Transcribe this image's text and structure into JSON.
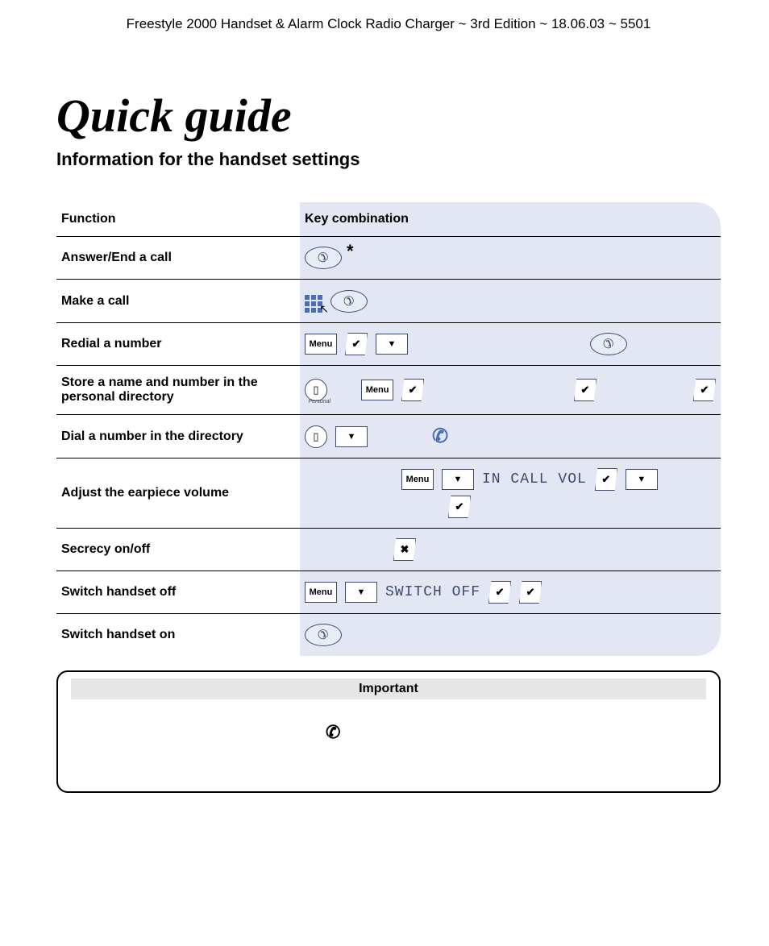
{
  "header": "Freestyle 2000 Handset & Alarm Clock Radio Charger  ~ 3rd Edition ~ 18.06.03 ~ 5501",
  "title": "Quick guide",
  "subtitle": "Information for the handset settings",
  "table": {
    "col_function": "Function",
    "col_key": "Key combination",
    "rows": {
      "answer_end": "Answer/End a call",
      "make_call": "Make a call",
      "redial": "Redial a number",
      "store": "Store a name and number in the personal directory",
      "dial_dir": "Dial a number in the directory",
      "volume": "Adjust the earpiece volume",
      "secrecy": "Secrecy on/off",
      "off": "Switch handset off",
      "on": "Switch handset on"
    }
  },
  "labels": {
    "menu": "Menu",
    "personal": "Personal",
    "in_call_vol": "IN CALL VOL",
    "switch_off": "SWITCH OFF",
    "asterisk": "*",
    "check": "✔",
    "down": "▼",
    "cross": "✖",
    "book": "▯"
  },
  "important": {
    "title": "Important"
  }
}
